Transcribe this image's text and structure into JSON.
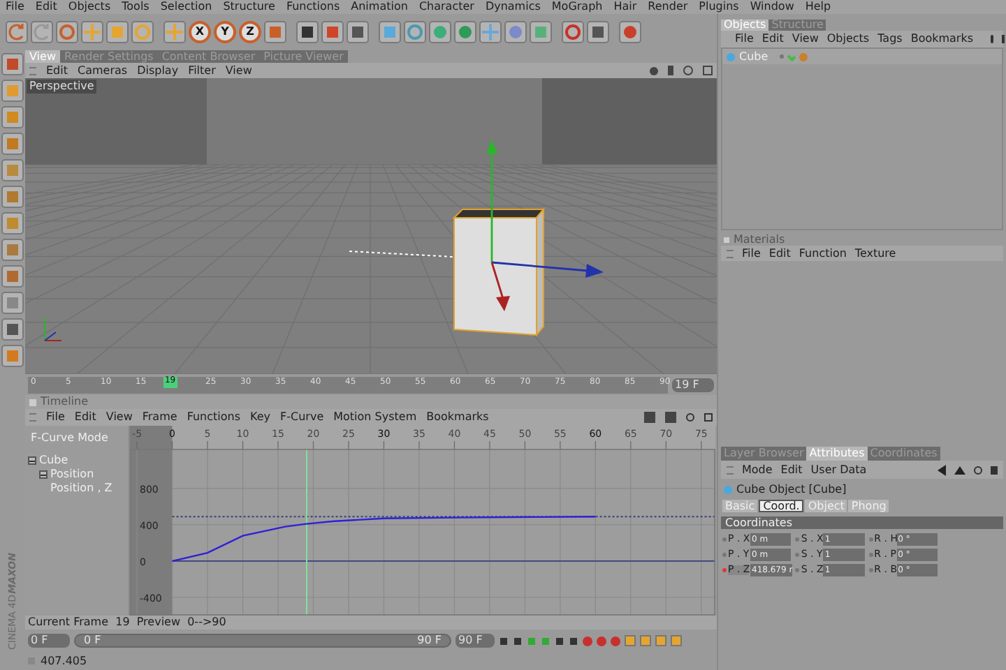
{
  "menubar": [
    "File",
    "Edit",
    "Objects",
    "Tools",
    "Selection",
    "Structure",
    "Functions",
    "Animation",
    "Character",
    "Dynamics",
    "MoGraph",
    "Hair",
    "Render",
    "Plugins",
    "Window",
    "Help"
  ],
  "toolbar": {
    "axis_buttons": [
      "X",
      "Y",
      "Z"
    ]
  },
  "viewport": {
    "tabs": [
      {
        "label": "View",
        "selected": true
      },
      {
        "label": "Render Settings",
        "selected": false
      },
      {
        "label": "Content Browser",
        "selected": false
      },
      {
        "label": "Picture Viewer",
        "selected": false
      }
    ],
    "menu": [
      "Edit",
      "Cameras",
      "Display",
      "Filter",
      "View"
    ],
    "camera_label": "Perspective"
  },
  "time_ruler": {
    "ticks": [
      "0",
      "5",
      "10",
      "15",
      "25",
      "30",
      "35",
      "40",
      "45",
      "50",
      "55",
      "60",
      "65",
      "70",
      "75",
      "80",
      "85",
      "90"
    ],
    "playhead": {
      "label": "19",
      "level": 0.211
    },
    "frame_field": "19 F"
  },
  "timeline": {
    "title": "Timeline",
    "menu": [
      "File",
      "Edit",
      "View",
      "Frame",
      "Functions",
      "Key",
      "F-Curve",
      "Motion System",
      "Bookmarks"
    ],
    "mode_label": "F-Curve Mode",
    "tracks": [
      {
        "label": "Cube",
        "expanded": true,
        "children": [
          {
            "label": "Position",
            "expanded": true,
            "children": [
              {
                "label": "Position , Z"
              }
            ]
          }
        ]
      }
    ],
    "chart_data": {
      "type": "line",
      "x": [
        0,
        5,
        10,
        16,
        19,
        23,
        30,
        40,
        60
      ],
      "series": [
        {
          "color": "#3020d8",
          "values": [
            0,
            90,
            280,
            380,
            410,
            440,
            470,
            480,
            490
          ]
        }
      ],
      "ref_lines": [
        {
          "axis": "y",
          "value": 0,
          "color": "#34407a"
        },
        {
          "axis": "y",
          "value": 490,
          "color": "#34407a"
        },
        {
          "axis": "x",
          "value": 19,
          "color": "#7fe09a"
        }
      ],
      "ylim": [
        -600,
        1230
      ],
      "xticks": [
        -5,
        0,
        5,
        10,
        15,
        20,
        25,
        30,
        35,
        40,
        45,
        50,
        55,
        60,
        65,
        70,
        75
      ],
      "xlim": [
        -6,
        77
      ],
      "yticks": [
        -400,
        0,
        400,
        800
      ],
      "grid": true
    }
  },
  "status": {
    "current_frame": "Current Frame  19  Preview  0-->90",
    "start_field": "0 F",
    "range_slider": {
      "start": "0 F",
      "end": "90 F",
      "level": 1
    },
    "end_field": "90 F",
    "readout": "407.405"
  },
  "brand": [
    "MAXON",
    "CINEMA 4D"
  ],
  "objects": {
    "tabs": [
      {
        "label": "Objects",
        "selected": true
      },
      {
        "label": "Structure",
        "selected": false
      }
    ],
    "menu": [
      "File",
      "Edit",
      "View",
      "Objects",
      "Tags",
      "Bookmarks"
    ],
    "rows": [
      {
        "label": "Cube"
      }
    ]
  },
  "materials": {
    "title": "Materials",
    "menu": [
      "File",
      "Edit",
      "Function",
      "Texture"
    ]
  },
  "attributes": {
    "tabs": [
      {
        "label": "Layer Browser",
        "selected": false
      },
      {
        "label": "Attributes",
        "selected": true
      },
      {
        "label": "Coordinates",
        "selected": false
      }
    ],
    "menu": [
      "Mode",
      "Edit",
      "User Data"
    ],
    "object_title": "Cube Object [Cube]",
    "subtabs": [
      {
        "label": "Basic",
        "selected": false
      },
      {
        "label": "Coord.",
        "selected": true
      },
      {
        "label": "Object",
        "selected": false
      },
      {
        "label": "Phong",
        "selected": false
      }
    ],
    "section": "Coordinates",
    "fields": [
      {
        "label": "P . X",
        "value": "0 m",
        "keyed": false
      },
      {
        "label": "S . X",
        "value": "1",
        "keyed": false
      },
      {
        "label": "R . H",
        "value": "0 °",
        "keyed": false
      },
      {
        "label": "P . Y",
        "value": "0 m",
        "keyed": false
      },
      {
        "label": "S . Y",
        "value": "1",
        "keyed": false
      },
      {
        "label": "R . P",
        "value": "0 °",
        "keyed": false
      },
      {
        "label": "P . Z",
        "value": "418.679 r",
        "keyed": true
      },
      {
        "label": "S . Z",
        "value": "1",
        "keyed": false
      },
      {
        "label": "R . B",
        "value": "0 °",
        "keyed": false
      }
    ]
  }
}
